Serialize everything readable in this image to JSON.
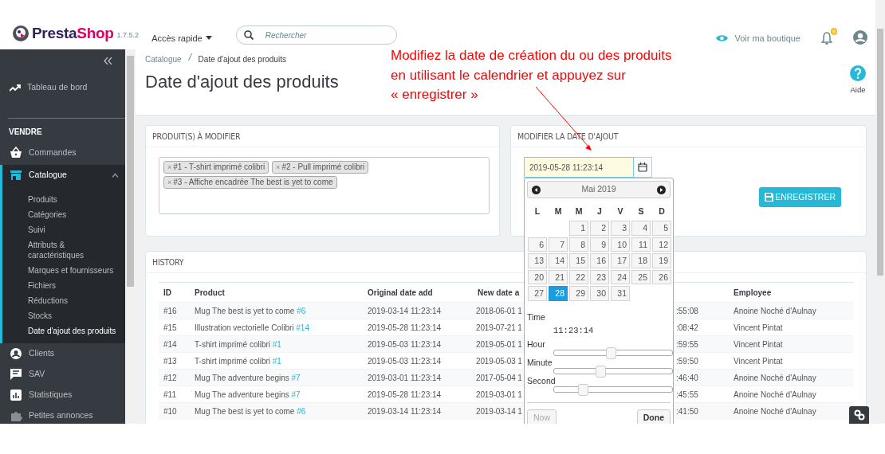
{
  "top_bar": {
    "logo_first": "Presta",
    "logo_second": "Shop",
    "version": "1.7.5.2",
    "quick_access": "Accès rapide",
    "search": {
      "placeholder": "Rechercher"
    },
    "shop_link": "Voir ma boutique",
    "notifications_badge": "9"
  },
  "sidebar": {
    "dashboard": "Tableau de bord",
    "section": "VENDRE",
    "items": [
      {
        "label": "Commandes",
        "selected": false
      },
      {
        "label": "Catalogue",
        "selected": true,
        "expanded": true,
        "children": [
          {
            "label": "Produits",
            "selected": false
          },
          {
            "label": "Catégories",
            "selected": false
          },
          {
            "label": "Suivi",
            "selected": false
          },
          {
            "label": "Attributs & caractéristiques",
            "selected": false
          },
          {
            "label": "Marques et fournisseurs",
            "selected": false
          },
          {
            "label": "Fichiers",
            "selected": false
          },
          {
            "label": "Réductions",
            "selected": false
          },
          {
            "label": "Stocks",
            "selected": false
          },
          {
            "label": "Date d'ajout des produits",
            "selected": true
          }
        ]
      },
      {
        "label": "Clients",
        "selected": false
      },
      {
        "label": "SAV",
        "selected": false
      },
      {
        "label": "Statistiques",
        "selected": false
      },
      {
        "label": "Petites annonces",
        "selected": false
      }
    ]
  },
  "breadcrumb": [
    "Catalogue",
    "Date d'ajout des produits"
  ],
  "page_title": "Date d'ajout des produits",
  "help": "Aide",
  "annotation": {
    "lines": [
      "Modifiez la date de création du ou des produits",
      "en utilisant le calendrier et appuyez sur",
      "« enregistrer »"
    ]
  },
  "products_panel": {
    "title": "PRODUIT(S) À MODIFIER",
    "tags": [
      {
        "label": "#1 - T-shirt imprimé colibri",
        "remove": "×"
      },
      {
        "label": "#2 - Pull imprimé colibri",
        "remove": "×"
      },
      {
        "label": "#3 - Affiche encadrée The best is yet to come",
        "remove": "×"
      }
    ]
  },
  "date_panel": {
    "title": "MODIFIER LA DATE D'AJOUT",
    "value": "2019-05-28 11:23:14",
    "save_button": "ENREGISTRER"
  },
  "datepicker": {
    "month": "Mai 2019",
    "weekdays": [
      "L",
      "M",
      "M",
      "J",
      "V",
      "S",
      "D"
    ],
    "weeks": [
      [
        {
          "kind": "blank"
        },
        {
          "kind": "blank"
        },
        {
          "label": "1",
          "selected": false
        },
        {
          "label": "2",
          "selected": false
        },
        {
          "label": "3",
          "selected": false
        },
        {
          "label": "4",
          "selected": false
        },
        {
          "label": "5",
          "selected": false
        }
      ],
      [
        {
          "label": "6",
          "selected": false
        },
        {
          "label": "7",
          "selected": false
        },
        {
          "label": "8",
          "selected": false
        },
        {
          "label": "9",
          "selected": false
        },
        {
          "label": "10",
          "selected": false
        },
        {
          "label": "11",
          "selected": false
        },
        {
          "label": "12",
          "selected": false
        }
      ],
      [
        {
          "label": "13",
          "selected": false
        },
        {
          "label": "14",
          "selected": false
        },
        {
          "label": "15",
          "selected": false
        },
        {
          "label": "16",
          "selected": false
        },
        {
          "label": "17",
          "selected": false
        },
        {
          "label": "18",
          "selected": false
        },
        {
          "label": "19",
          "selected": false
        }
      ],
      [
        {
          "label": "20",
          "selected": false
        },
        {
          "label": "21",
          "selected": false
        },
        {
          "label": "22",
          "selected": false
        },
        {
          "label": "23",
          "selected": false
        },
        {
          "label": "24",
          "selected": false
        },
        {
          "label": "25",
          "selected": false
        },
        {
          "label": "26",
          "selected": false
        }
      ],
      [
        {
          "label": "27",
          "selected": false
        },
        {
          "label": "28",
          "selected": true
        },
        {
          "label": "29",
          "selected": false
        },
        {
          "label": "30",
          "selected": false
        },
        {
          "label": "31",
          "selected": false
        },
        {
          "kind": "blank"
        },
        {
          "kind": "blank"
        }
      ]
    ],
    "time_label": "Time",
    "time": "11:23:14",
    "sliders": [
      {
        "label": "Hour",
        "level": 0.48
      },
      {
        "label": "Minute",
        "level": 0.39
      },
      {
        "label": "Second",
        "level": 0.24
      }
    ],
    "now_button": {
      "label": "Now",
      "disabled": true
    },
    "done_button": "Done"
  },
  "history": {
    "title": "HISTORY",
    "columns": [
      "ID",
      "Product",
      "Original date add",
      "New date a",
      "Employee"
    ],
    "rows": [
      {
        "id": "#16",
        "product": "Mug The best is yet to come",
        "product_link": "#6",
        "original": "2019-03-14 11:23:14",
        "new": "2018-06-01 1",
        "column_5": ":55:08",
        "employee": "Anoine Noché d'Aulnay"
      },
      {
        "id": "#15",
        "product": "Illustration vectorielle Colibri",
        "product_link": "#14",
        "original": "2019-05-28 11:23:14",
        "new": "2019-07-21 1",
        "column_5": ":08:42",
        "employee": "Vincent Pintat"
      },
      {
        "id": "#14",
        "product": "T-shirt imprimé colibri",
        "product_link": "#1",
        "original": "2019-05-03 11:23:14",
        "new": "2019-05-01 1",
        "column_5": ":59:55",
        "employee": "Vincent Pintat"
      },
      {
        "id": "#13",
        "product": "T-shirt imprimé colibri",
        "product_link": "#1",
        "original": "2019-05-03 11:23:14",
        "new": "2019-05-03 1",
        "column_5": ":59:50",
        "employee": "Vincent Pintat"
      },
      {
        "id": "#12",
        "product": "Mug The adventure begins",
        "product_link": "#7",
        "original": "2019-03-01 11:23:14",
        "new": "2017-05-04 1",
        "column_5": ":46:40",
        "employee": "Anoine Noché d'Aulnay"
      },
      {
        "id": "#11",
        "product": "Mug The adventure begins",
        "product_link": "#7",
        "original": "2019-05-28 11:23:14",
        "new": "2019-03-01 1",
        "column_5": ":45:55",
        "employee": "Anoine Noché d'Aulnay"
      },
      {
        "id": "#10",
        "product": "Mug The best is yet to come",
        "product_link": "#6",
        "original": "2019-03-14 11:23:14",
        "new": "2019-03-14 1",
        "column_5": ":41:50",
        "employee": "Anoine Noché d'Aulnay"
      }
    ]
  }
}
